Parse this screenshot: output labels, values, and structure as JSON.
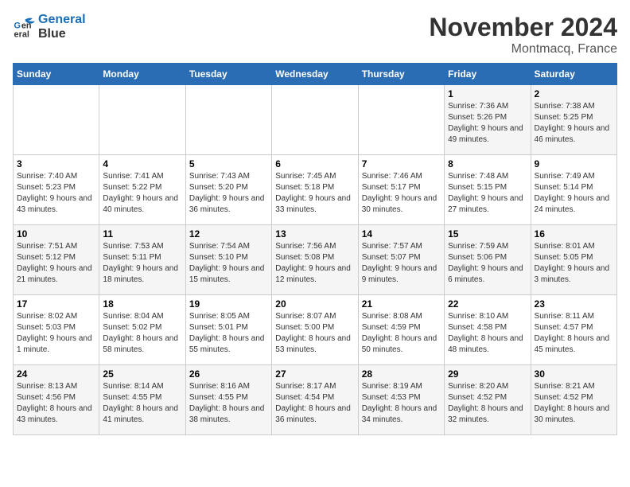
{
  "header": {
    "logo_line1": "General",
    "logo_line2": "Blue",
    "month_title": "November 2024",
    "location": "Montmacq, France"
  },
  "days_of_week": [
    "Sunday",
    "Monday",
    "Tuesday",
    "Wednesday",
    "Thursday",
    "Friday",
    "Saturday"
  ],
  "weeks": [
    [
      {
        "day": "",
        "info": ""
      },
      {
        "day": "",
        "info": ""
      },
      {
        "day": "",
        "info": ""
      },
      {
        "day": "",
        "info": ""
      },
      {
        "day": "",
        "info": ""
      },
      {
        "day": "1",
        "info": "Sunrise: 7:36 AM\nSunset: 5:26 PM\nDaylight: 9 hours and 49 minutes."
      },
      {
        "day": "2",
        "info": "Sunrise: 7:38 AM\nSunset: 5:25 PM\nDaylight: 9 hours and 46 minutes."
      }
    ],
    [
      {
        "day": "3",
        "info": "Sunrise: 7:40 AM\nSunset: 5:23 PM\nDaylight: 9 hours and 43 minutes."
      },
      {
        "day": "4",
        "info": "Sunrise: 7:41 AM\nSunset: 5:22 PM\nDaylight: 9 hours and 40 minutes."
      },
      {
        "day": "5",
        "info": "Sunrise: 7:43 AM\nSunset: 5:20 PM\nDaylight: 9 hours and 36 minutes."
      },
      {
        "day": "6",
        "info": "Sunrise: 7:45 AM\nSunset: 5:18 PM\nDaylight: 9 hours and 33 minutes."
      },
      {
        "day": "7",
        "info": "Sunrise: 7:46 AM\nSunset: 5:17 PM\nDaylight: 9 hours and 30 minutes."
      },
      {
        "day": "8",
        "info": "Sunrise: 7:48 AM\nSunset: 5:15 PM\nDaylight: 9 hours and 27 minutes."
      },
      {
        "day": "9",
        "info": "Sunrise: 7:49 AM\nSunset: 5:14 PM\nDaylight: 9 hours and 24 minutes."
      }
    ],
    [
      {
        "day": "10",
        "info": "Sunrise: 7:51 AM\nSunset: 5:12 PM\nDaylight: 9 hours and 21 minutes."
      },
      {
        "day": "11",
        "info": "Sunrise: 7:53 AM\nSunset: 5:11 PM\nDaylight: 9 hours and 18 minutes."
      },
      {
        "day": "12",
        "info": "Sunrise: 7:54 AM\nSunset: 5:10 PM\nDaylight: 9 hours and 15 minutes."
      },
      {
        "day": "13",
        "info": "Sunrise: 7:56 AM\nSunset: 5:08 PM\nDaylight: 9 hours and 12 minutes."
      },
      {
        "day": "14",
        "info": "Sunrise: 7:57 AM\nSunset: 5:07 PM\nDaylight: 9 hours and 9 minutes."
      },
      {
        "day": "15",
        "info": "Sunrise: 7:59 AM\nSunset: 5:06 PM\nDaylight: 9 hours and 6 minutes."
      },
      {
        "day": "16",
        "info": "Sunrise: 8:01 AM\nSunset: 5:05 PM\nDaylight: 9 hours and 3 minutes."
      }
    ],
    [
      {
        "day": "17",
        "info": "Sunrise: 8:02 AM\nSunset: 5:03 PM\nDaylight: 9 hours and 1 minute."
      },
      {
        "day": "18",
        "info": "Sunrise: 8:04 AM\nSunset: 5:02 PM\nDaylight: 8 hours and 58 minutes."
      },
      {
        "day": "19",
        "info": "Sunrise: 8:05 AM\nSunset: 5:01 PM\nDaylight: 8 hours and 55 minutes."
      },
      {
        "day": "20",
        "info": "Sunrise: 8:07 AM\nSunset: 5:00 PM\nDaylight: 8 hours and 53 minutes."
      },
      {
        "day": "21",
        "info": "Sunrise: 8:08 AM\nSunset: 4:59 PM\nDaylight: 8 hours and 50 minutes."
      },
      {
        "day": "22",
        "info": "Sunrise: 8:10 AM\nSunset: 4:58 PM\nDaylight: 8 hours and 48 minutes."
      },
      {
        "day": "23",
        "info": "Sunrise: 8:11 AM\nSunset: 4:57 PM\nDaylight: 8 hours and 45 minutes."
      }
    ],
    [
      {
        "day": "24",
        "info": "Sunrise: 8:13 AM\nSunset: 4:56 PM\nDaylight: 8 hours and 43 minutes."
      },
      {
        "day": "25",
        "info": "Sunrise: 8:14 AM\nSunset: 4:55 PM\nDaylight: 8 hours and 41 minutes."
      },
      {
        "day": "26",
        "info": "Sunrise: 8:16 AM\nSunset: 4:55 PM\nDaylight: 8 hours and 38 minutes."
      },
      {
        "day": "27",
        "info": "Sunrise: 8:17 AM\nSunset: 4:54 PM\nDaylight: 8 hours and 36 minutes."
      },
      {
        "day": "28",
        "info": "Sunrise: 8:19 AM\nSunset: 4:53 PM\nDaylight: 8 hours and 34 minutes."
      },
      {
        "day": "29",
        "info": "Sunrise: 8:20 AM\nSunset: 4:52 PM\nDaylight: 8 hours and 32 minutes."
      },
      {
        "day": "30",
        "info": "Sunrise: 8:21 AM\nSunset: 4:52 PM\nDaylight: 8 hours and 30 minutes."
      }
    ]
  ]
}
